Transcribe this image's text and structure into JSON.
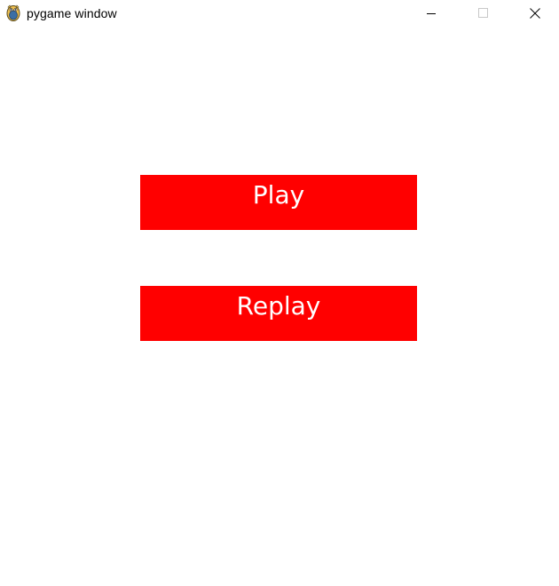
{
  "window": {
    "title": "pygame window",
    "app_icon": "pygame-snake-icon",
    "controls": {
      "minimize_icon": "minimize-icon",
      "maximize_icon": "maximize-icon",
      "close_icon": "close-icon"
    }
  },
  "game": {
    "background_color": "#ffffff",
    "button_color": "#ff0000",
    "button_text_color": "#ffffff",
    "buttons": [
      {
        "label": "Play"
      },
      {
        "label": "Replay"
      }
    ]
  }
}
